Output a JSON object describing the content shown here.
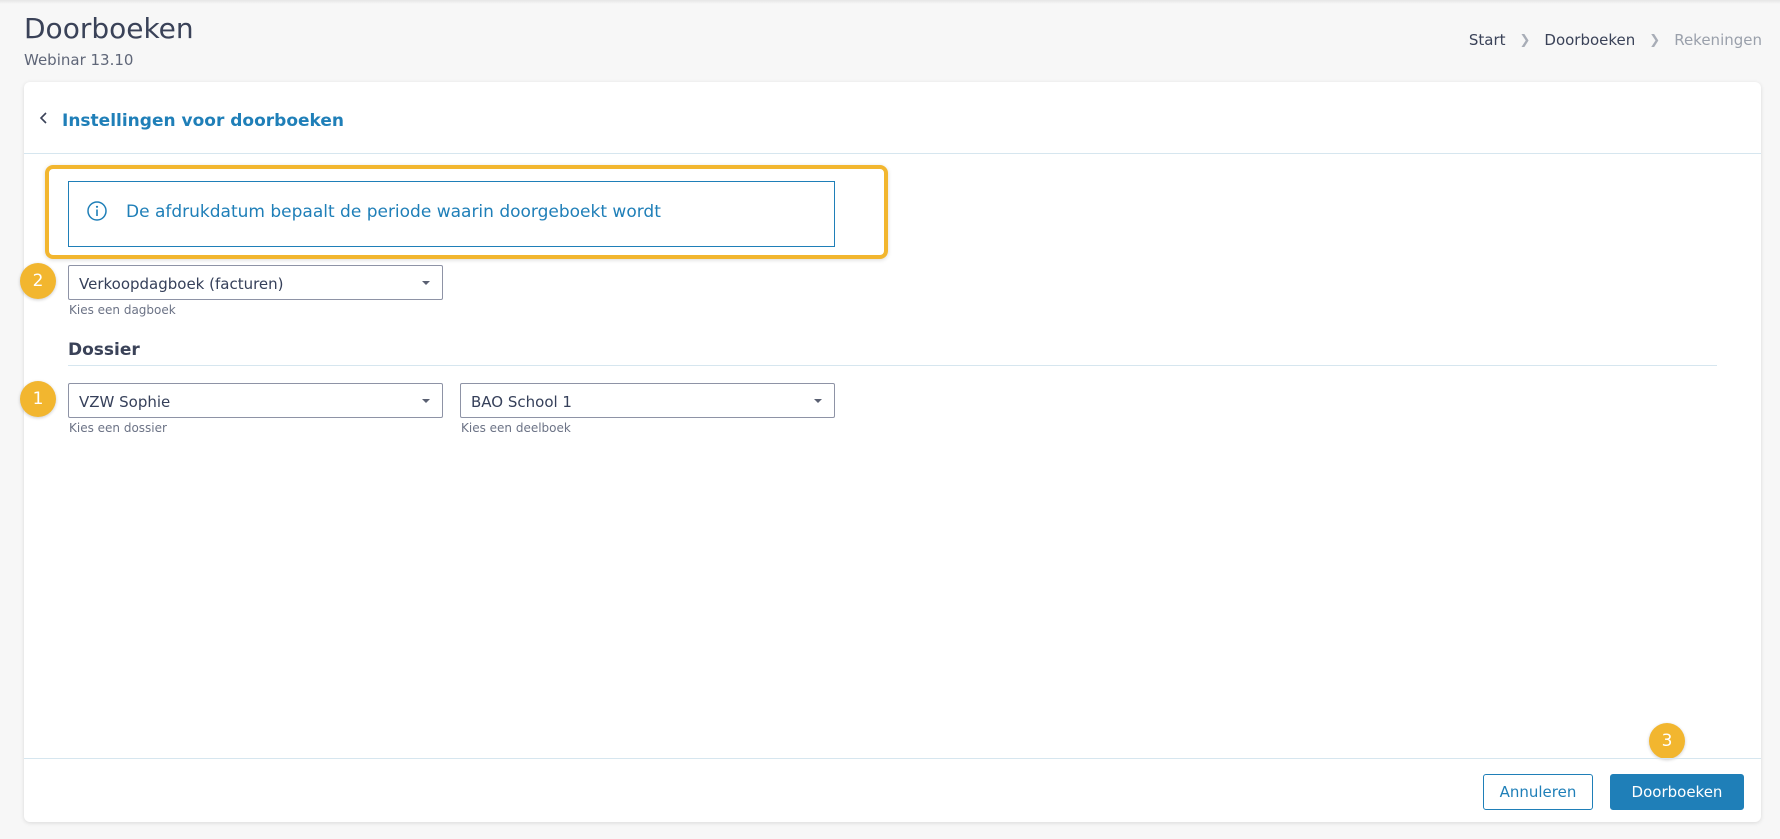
{
  "page": {
    "title": "Doorboeken",
    "subtitle": "Webinar 13.10"
  },
  "breadcrumb": {
    "items": [
      "Start",
      "Doorboeken",
      "Rekeningen"
    ]
  },
  "card": {
    "header_title": "Instellingen voor doorboeken",
    "info_text": "De afdrukdatum bepaalt de periode waarin doorgeboekt wordt",
    "journal": {
      "value": "Verkoopdagboek (facturen)",
      "helper": "Kies een dagboek"
    },
    "section_title": "Dossier",
    "dossier": {
      "value": "VZW Sophie",
      "helper": "Kies een dossier"
    },
    "subledger": {
      "value": "BAO School 1",
      "helper": "Kies een deelboek"
    },
    "badges": [
      "1",
      "2",
      "3"
    ]
  },
  "footer": {
    "cancel_label": "Annuleren",
    "submit_label": "Doorboeken"
  },
  "colors": {
    "accent": "#1f7fb8",
    "highlight": "#f2b62f",
    "background": "#f7f7f7"
  }
}
